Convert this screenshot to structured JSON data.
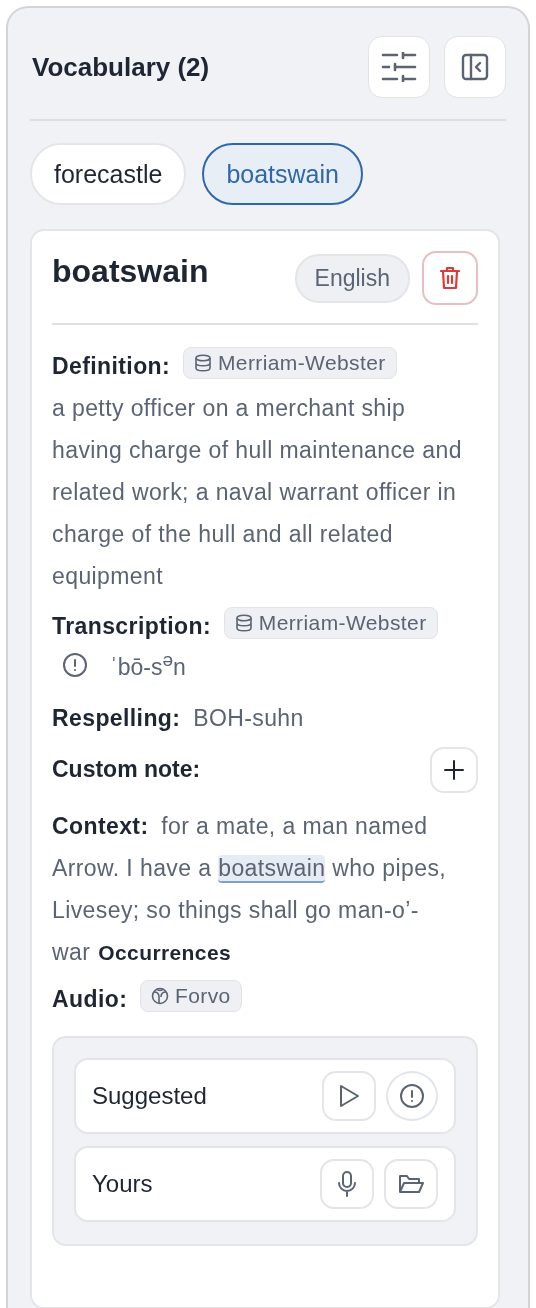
{
  "header": {
    "title": "Vocabulary (2)"
  },
  "words": [
    {
      "label": "forecastle",
      "selected": false
    },
    {
      "label": "boatswain",
      "selected": true
    }
  ],
  "entry": {
    "word": "boatswain",
    "language": "English",
    "definition": {
      "label": "Definition:",
      "source": "Merriam-Webster",
      "text": "a petty officer on a merchant ship having charge of hull maintenance and related work; a naval warrant officer in charge of the hull and all related equipment"
    },
    "transcription": {
      "label": "Transcription:",
      "source": "Merriam-Webster",
      "text": "ˈbō-s$^{ə}$n"
    },
    "respelling": {
      "label": "Respelling:",
      "text": "BOH-suhn"
    },
    "custom_note": {
      "label": "Custom note:"
    },
    "context": {
      "label": "Context:",
      "before": "for a mate, a man named Arrow. I have a ",
      "highlight": "boatswain",
      "after": " who pipes, Livesey; so things shall go man-o’-war",
      "link": "Occurrences"
    },
    "audio": {
      "label": "Audio:",
      "source": "Forvo",
      "rows": [
        {
          "label": "Suggested",
          "kind": "suggested"
        },
        {
          "label": "Yours",
          "kind": "yours"
        }
      ]
    }
  }
}
